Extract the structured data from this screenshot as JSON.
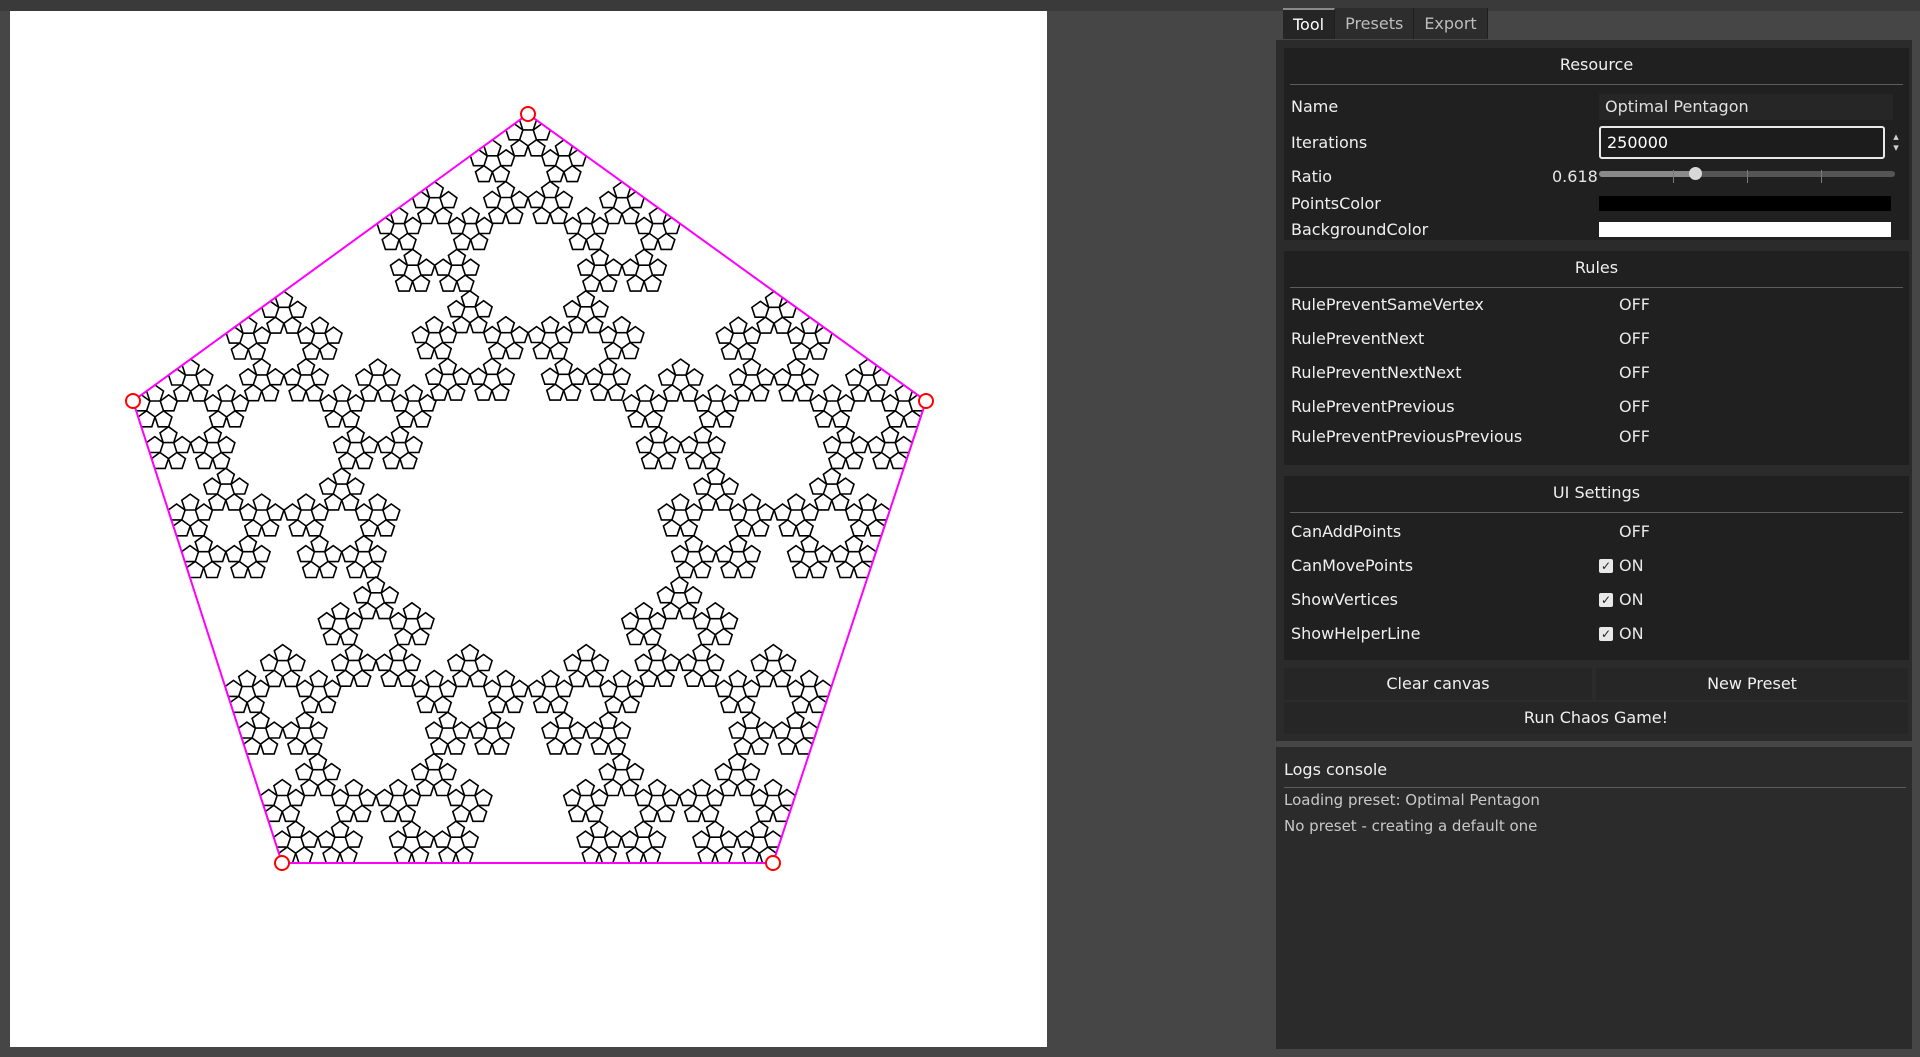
{
  "tabs": [
    "Tool",
    "Presets",
    "Export"
  ],
  "resource": {
    "title": "Resource",
    "name_label": "Name",
    "name_value": "Optimal Pentagon",
    "iterations_label": "Iterations",
    "iterations_value": "250000",
    "ratio_label": "Ratio",
    "ratio_value": "0.618",
    "points_color_label": "PointsColor",
    "points_color": "#000000",
    "background_color_label": "BackgroundColor",
    "background_color": "#ffffff"
  },
  "rules": {
    "title": "Rules",
    "items": [
      {
        "label": "RulePreventSameVertex",
        "state": "OFF"
      },
      {
        "label": "RulePreventNext",
        "state": "OFF"
      },
      {
        "label": "RulePreventNextNext",
        "state": "OFF"
      },
      {
        "label": "RulePreventPrevious",
        "state": "OFF"
      },
      {
        "label": "RulePreventPreviousPrevious",
        "state": "OFF"
      }
    ]
  },
  "ui_settings": {
    "title": "UI Settings",
    "items": [
      {
        "label": "CanAddPoints",
        "state": "OFF"
      },
      {
        "label": "CanMovePoints",
        "state": "ON"
      },
      {
        "label": "ShowVertices",
        "state": "ON"
      },
      {
        "label": "ShowHelperLine",
        "state": "ON"
      }
    ]
  },
  "buttons": {
    "clear": "Clear canvas",
    "new_preset": "New Preset",
    "run": "Run Chaos Game!"
  },
  "logs": {
    "title": "Logs console",
    "lines": [
      "Loading preset: Optimal Pentagon",
      "No preset - creating a default one"
    ]
  },
  "colors": {
    "vertex": "#ff0000",
    "helper_line": "#ff00ff",
    "fractal": "#000000"
  }
}
